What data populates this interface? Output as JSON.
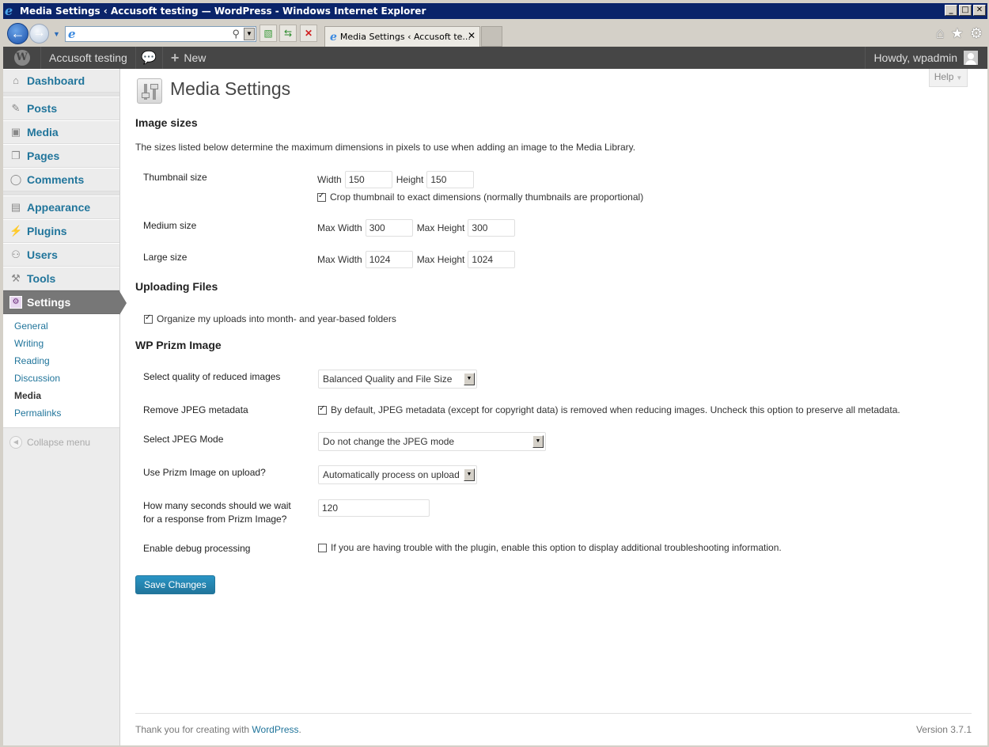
{
  "browser": {
    "window_title": "Media Settings ‹ Accusoft testing — WordPress - Windows Internet Explorer",
    "address_value": "",
    "tab_title": "Media Settings ‹ Accusoft te...",
    "window_buttons": [
      "_",
      "□",
      "✕"
    ]
  },
  "adminbar": {
    "site_name": "Accusoft testing",
    "new_label": "New",
    "howdy": "Howdy, wpadmin"
  },
  "sidebar": {
    "items": [
      {
        "label": "Dashboard",
        "icon": "home-icon"
      },
      {
        "label": "Posts",
        "icon": "pin-icon"
      },
      {
        "label": "Media",
        "icon": "media-icon"
      },
      {
        "label": "Pages",
        "icon": "pages-icon"
      },
      {
        "label": "Comments",
        "icon": "comment-icon"
      },
      {
        "label": "Appearance",
        "icon": "appearance-icon"
      },
      {
        "label": "Plugins",
        "icon": "plug-icon"
      },
      {
        "label": "Users",
        "icon": "users-icon"
      },
      {
        "label": "Tools",
        "icon": "tools-icon"
      },
      {
        "label": "Settings",
        "icon": "settings-icon"
      }
    ],
    "submenu": [
      "General",
      "Writing",
      "Reading",
      "Discussion",
      "Media",
      "Permalinks"
    ],
    "active_submenu": "Media",
    "collapse_label": "Collapse menu"
  },
  "help": {
    "label": "Help"
  },
  "page": {
    "title": "Media Settings",
    "image_sizes": {
      "heading": "Image sizes",
      "description": "The sizes listed below determine the maximum dimensions in pixels to use when adding an image to the Media Library.",
      "thumbnail": {
        "label": "Thumbnail size",
        "width_label": "Width",
        "width": "150",
        "height_label": "Height",
        "height": "150",
        "crop_checked": true,
        "crop_label": "Crop thumbnail to exact dimensions (normally thumbnails are proportional)"
      },
      "medium": {
        "label": "Medium size",
        "width_label": "Max Width",
        "width": "300",
        "height_label": "Max Height",
        "height": "300"
      },
      "large": {
        "label": "Large size",
        "width_label": "Max Width",
        "width": "1024",
        "height_label": "Max Height",
        "height": "1024"
      }
    },
    "uploading": {
      "heading": "Uploading Files",
      "organize_checked": true,
      "organize_label": "Organize my uploads into month- and year-based folders"
    },
    "prizm": {
      "heading": "WP Prizm Image",
      "quality": {
        "label": "Select quality of reduced images",
        "value": "Balanced Quality and File Size"
      },
      "metadata": {
        "label": "Remove JPEG metadata",
        "checked": true,
        "text": "By default, JPEG metadata (except for copyright data) is removed when reducing images. Uncheck this option to preserve all metadata."
      },
      "jpeg_mode": {
        "label": "Select JPEG Mode",
        "value": "Do not change the JPEG mode"
      },
      "on_upload": {
        "label": "Use Prizm Image on upload?",
        "value": "Automatically process on upload"
      },
      "timeout": {
        "label_line1": "How many seconds should we wait",
        "label_line2": "for a response from Prizm Image?",
        "value": "120"
      },
      "debug": {
        "label": "Enable debug processing",
        "checked": false,
        "text": "If you are having trouble with the plugin, enable this option to display additional troubleshooting information."
      }
    },
    "save_label": "Save Changes"
  },
  "footer": {
    "thanks_prefix": "Thank you for creating with ",
    "thanks_link": "WordPress",
    "thanks_suffix": ".",
    "version": "Version 3.7.1"
  }
}
